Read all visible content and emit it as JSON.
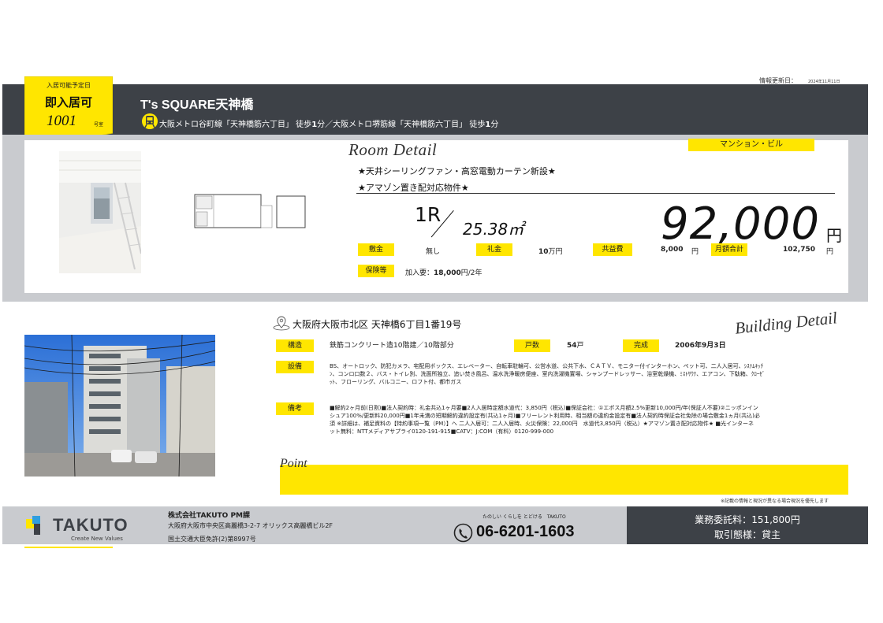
{
  "header": {
    "update_label": "情報更新日：",
    "update_date": "2024年11月11日",
    "title_en": "T's SQUARE",
    "title_jp": "天神橋",
    "access_a": "大阪メトロ谷町線「天神橋筋六丁目」 徒歩",
    "access_a_min": "1",
    "access_a_unit": "分／大阪メトロ堺筋線「天神橋筋六丁目」 徒歩",
    "access_b_min": "1",
    "access_b_unit": "分"
  },
  "badge": {
    "label": "入居可能予定日",
    "availability": "即入居可",
    "room_number": "1001",
    "room_suffix": "号室"
  },
  "room": {
    "section_title": "Room Detail",
    "type": "マンション・ビル",
    "feature_1": "★天井シーリングファン・高窓電動カーテン新設★",
    "feature_2": "★アマゾン置き配対応物件★",
    "layout": "1R",
    "area": "25.38㎡",
    "rent": "92,000",
    "rent_unit": "円",
    "deposit_label": "敷金",
    "deposit_value": "無し",
    "key_money_label": "礼金",
    "key_money_value": "10",
    "key_money_unit": "万円",
    "common_fee_label": "共益費",
    "common_fee_value": "8,000",
    "common_fee_unit": "円",
    "monthly_total_label": "月額合計",
    "monthly_total_value": "102,750",
    "monthly_total_unit": "円",
    "insurance_label": "保険等",
    "insurance_prefix": "加入要：",
    "insurance_value": "18,000",
    "insurance_unit": "円/2年"
  },
  "building": {
    "section_title": "Building Detail",
    "address": "大阪府大阪市北区 天神橋6丁目1番19号",
    "structure_label": "構造",
    "structure_value": "鉄筋コンクリート造10階建／10階部分",
    "units_label": "戸数",
    "units_value": "54",
    "units_unit": "戸",
    "completed_label": "完成",
    "completed_value": "2006年9月3日",
    "facilities_label": "設備",
    "facilities_line1": "BS、オートロック、防犯カメラ、宅配用ボックス、エレベーター、自転車駐輪可、公営水道、公共下水、ＣＡＴＶ、モニター付インターホン、ペット可、二人入居可、ｼｽﾃﾑｷｯﾁ",
    "facilities_line2": "ﾝ、コンロ口数２、バス・トイレ別、洗面所独立、追い焚き風呂、温水洗浄暖房便座、室内洗濯機置場、シャンプードレッサー、浴室乾燥機、ﾐｽﾄｻｳﾅ、エアコン、下駄箱、ｸﾛｰｾﾞ",
    "facilities_line3": "ｯﾄ、フローリング、バルコニー、ロフト付、都市ガス",
    "remarks_label": "備考",
    "remarks_line1": "■解約2ヶ月前(日割)■法人契約時：礼金共込1ヶ月要■2人入居時定額水道代：3,850円（税込)■保証会社：①エポス月額2.5%更新10,000円/年(保証人不要)②ニッポンイン",
    "remarks_line2": "シュア100%/更新料20,000円■1年未満の短期解約違約設定有(共込1ヶ月)■フリーレント利用時、相当額の違約金設定有■法人契約時保証会社免除の場合敷金1ヵ月(共込)必",
    "remarks_line3": "須 ※詳細は、補足資料の【特約事項一覧（PM）】へ 二人入居可：二人入居時、火災保険：22,000円　水道代3,850円（税込）★アマゾン置き配対応物件★ ■光インターネ",
    "remarks_line4": "ット無料：NTTメディアサプライ0120-191-915■CATV：J:COM（有料）0120-999-000",
    "point_title": "Point",
    "disclaimer": "※記載の情報と現況が異なる場合現況を優先します"
  },
  "footer": {
    "logo": "TAKUTO",
    "logo_tagline": "Create New Values",
    "company": "株式会社TAKUTO PM課",
    "address": "大阪府大阪市中央区高麗橋3-2-7 オリックス高麗橋ビル2F",
    "license": "国土交通大臣免許(2)第8997号",
    "catchphrase": "たのしい くらしを とどける　TAKUTO",
    "phone": "06-6201-1603",
    "fee_label": "業務委託料：",
    "fee_value": "151,800円",
    "deal_label": "取引態様：",
    "deal_value": "貸主"
  },
  "colors": {
    "accent_yellow": "#ffe600",
    "dark_bar": "#3d4147",
    "light_band": "#c9cbcf"
  }
}
